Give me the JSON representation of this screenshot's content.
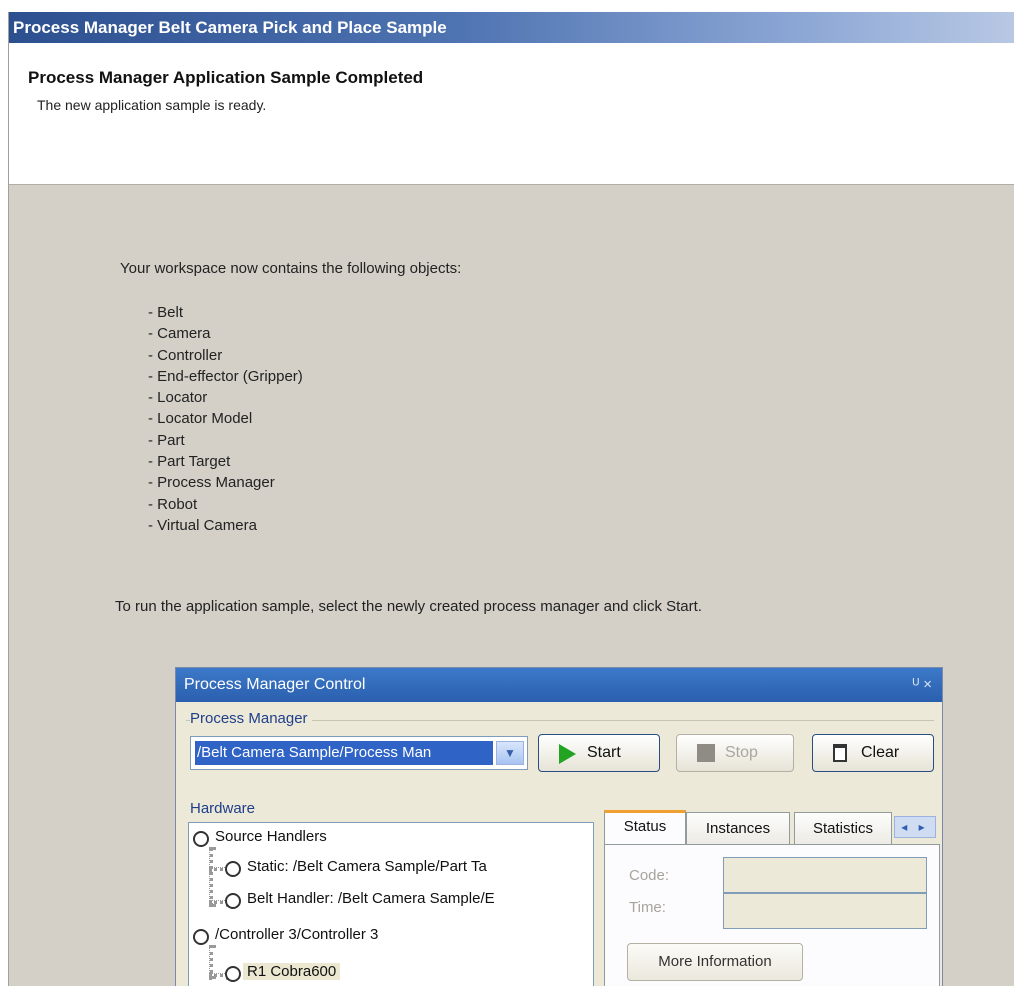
{
  "window": {
    "title": "Process Manager Belt Camera Pick and Place Sample"
  },
  "header": {
    "title": "Process Manager Application Sample Completed",
    "subtitle": "The new application sample is ready."
  },
  "content": {
    "intro": "Your workspace now contains the following objects:",
    "objects": [
      "- Belt",
      "- Camera",
      "- Controller",
      "- End-effector (Gripper)",
      "- Locator",
      "- Locator Model",
      "- Part",
      "- Part Target",
      "- Process Manager",
      "- Robot",
      "- Virtual Camera"
    ],
    "outro": "To run the application sample, select the newly created process manager and click Start."
  },
  "pm_control": {
    "title": "Process Manager Control",
    "title_controls": "Ɱ ×",
    "process_manager_label": "Process Manager",
    "process_manager_value": "/Belt Camera Sample/Process Man",
    "start_label": "Start",
    "stop_label": "Stop",
    "clear_label": "Clear",
    "hardware_label": "Hardware",
    "tree": [
      "Source Handlers",
      "Static: /Belt Camera Sample/Part Ta",
      "Belt Handler: /Belt Camera Sample/E",
      "/Controller 3/Controller 3",
      "R1 Cobra600"
    ],
    "tabs": [
      "Status",
      "Instances",
      "Statistics"
    ],
    "tab_arrows": "◂ ▸",
    "code_label": "Code:",
    "time_label": "Time:",
    "more_info_label": "More Information"
  },
  "colors": {
    "title_gradient_start": "#2c4f8f",
    "panel_bg": "#d4d0c8",
    "selection": "#2f63c6",
    "start_icon": "#22a322",
    "active_tab_accent": "#f0a030"
  },
  "icons": [
    "start-play-icon",
    "stop-square-icon",
    "clear-clipboard-icon",
    "dropdown-chevron-icon",
    "pin-icon",
    "close-icon",
    "radio-icon"
  ]
}
